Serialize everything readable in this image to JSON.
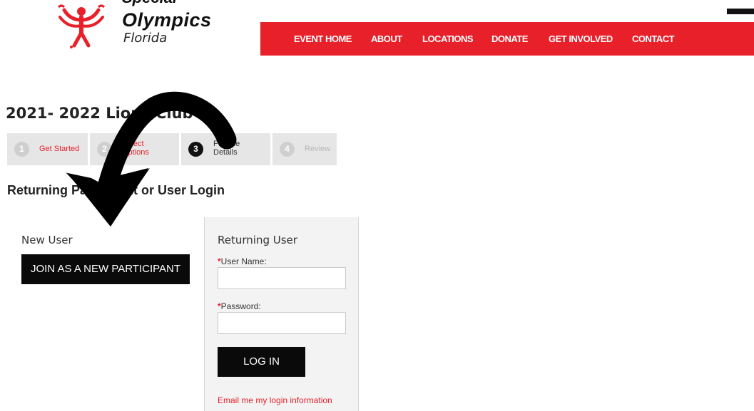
{
  "brand": {
    "line1": "Special",
    "line2": "Olympics",
    "line3": "Florida",
    "logo_icon": "special-olympics-figure-icon",
    "accent_color": "#e8202a"
  },
  "nav": {
    "items": [
      {
        "label": "EVENT HOME"
      },
      {
        "label": "ABOUT"
      },
      {
        "label": "LOCATIONS"
      },
      {
        "label": "DONATE"
      },
      {
        "label": "GET INVOLVED"
      },
      {
        "label": "CONTACT"
      }
    ]
  },
  "page": {
    "title": "2021- 2022 Lions Club"
  },
  "steps": [
    {
      "number": "1",
      "label": "Get Started",
      "state": "completed"
    },
    {
      "number": "2",
      "label": "Select\nOptions",
      "state": "completed"
    },
    {
      "number": "3",
      "label": "Provide\nDetails",
      "state": "active"
    },
    {
      "number": "4",
      "label": "Review",
      "state": "upcoming"
    }
  ],
  "login": {
    "heading": "Returning Participant or User Login",
    "new_user_label": "New User",
    "join_button": "JOIN AS A NEW PARTICIPANT",
    "returning_title": "Returning User",
    "username_label": "User Name:",
    "username_required": "*",
    "username_value": "",
    "password_label": "Password:",
    "password_required": "*",
    "password_value": "",
    "login_button": "LOG IN",
    "email_link": "Email me my login information"
  },
  "overlay": {
    "arrow_icon": "curved-arrow-icon",
    "arrow_color": "#000000"
  }
}
